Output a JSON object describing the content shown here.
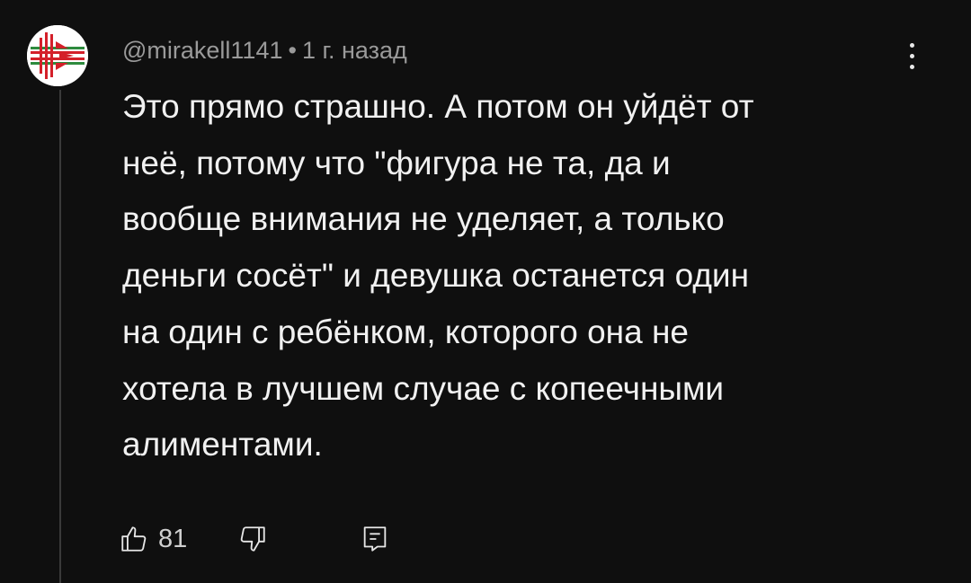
{
  "comment": {
    "author": "@mirakell1141",
    "separator": "•",
    "time": "1 г. назад",
    "text": "Это прямо страшно. А потом он уйдёт от\nнеё, потому что \"фигура не та, да и\nвообще внимания не уделяет, а только\nденьги сосёт\" и девушка останется один\nна один с ребёнком, которого она не\nхотела в лучшем случае с копеечными\nалиментами.",
    "likes": "81"
  },
  "icons": {
    "avatar": "avatar-emblem",
    "menu": "more-vertical-icon",
    "like": "thumbs-up-icon",
    "dislike": "thumbs-down-icon",
    "reply": "reply-comment-icon"
  },
  "colors": {
    "background": "#0f0f0f",
    "text": "#f1f1f1",
    "meta": "#9a9a9a",
    "emblem_red": "#d4202a",
    "emblem_green": "#2e8b3e"
  }
}
